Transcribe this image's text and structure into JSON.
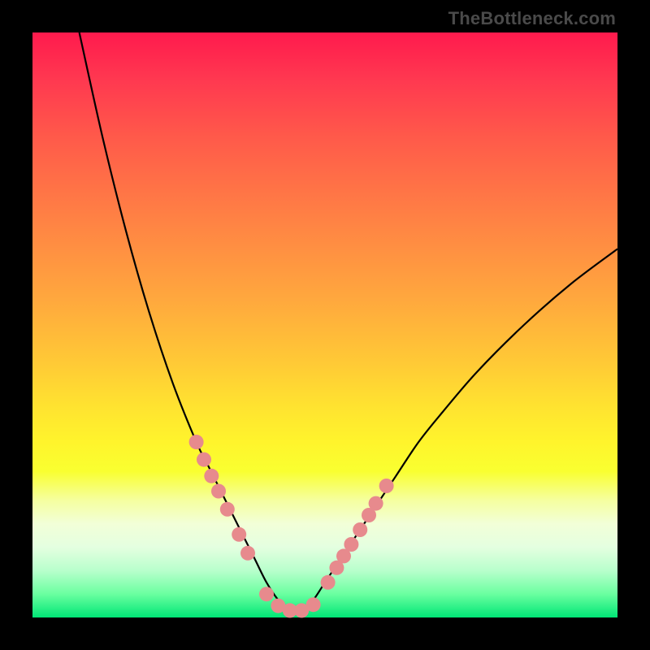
{
  "watermark": "TheBottleneck.com",
  "colors": {
    "marker": "#e78a8d",
    "curve": "#000000",
    "frame": "#000000"
  },
  "chart_data": {
    "type": "line",
    "title": "",
    "xlabel": "",
    "ylabel": "",
    "xlim": [
      0,
      100
    ],
    "ylim": [
      0,
      100
    ],
    "grid": false,
    "legend": false,
    "series": [
      {
        "name": "bottleneck-curve",
        "x": [
          8,
          12,
          16,
          20,
          24,
          28,
          30,
          32,
          34,
          36,
          38,
          40,
          42,
          44,
          46,
          48,
          50,
          54,
          58,
          62,
          66,
          70,
          76,
          84,
          92,
          100
        ],
        "y": [
          100,
          82,
          66,
          52,
          40,
          30,
          26,
          22,
          18,
          14,
          10,
          6,
          3,
          1,
          1,
          3,
          6,
          12,
          18,
          24,
          30,
          35,
          42,
          50,
          57,
          63
        ]
      }
    ],
    "markers": {
      "name": "highlight-points",
      "x": [
        28.0,
        29.3,
        30.6,
        31.8,
        33.3,
        35.3,
        36.8,
        40.0,
        42.0,
        44.0,
        46.0,
        48.0,
        50.5,
        52.0,
        53.2,
        54.5,
        56.0,
        57.5,
        58.7,
        60.5
      ],
      "y": [
        30.0,
        27.0,
        24.2,
        21.6,
        18.5,
        14.2,
        11.0,
        4.0,
        2.0,
        1.2,
        1.2,
        2.2,
        6.0,
        8.5,
        10.5,
        12.5,
        15.0,
        17.5,
        19.5,
        22.5
      ]
    }
  }
}
